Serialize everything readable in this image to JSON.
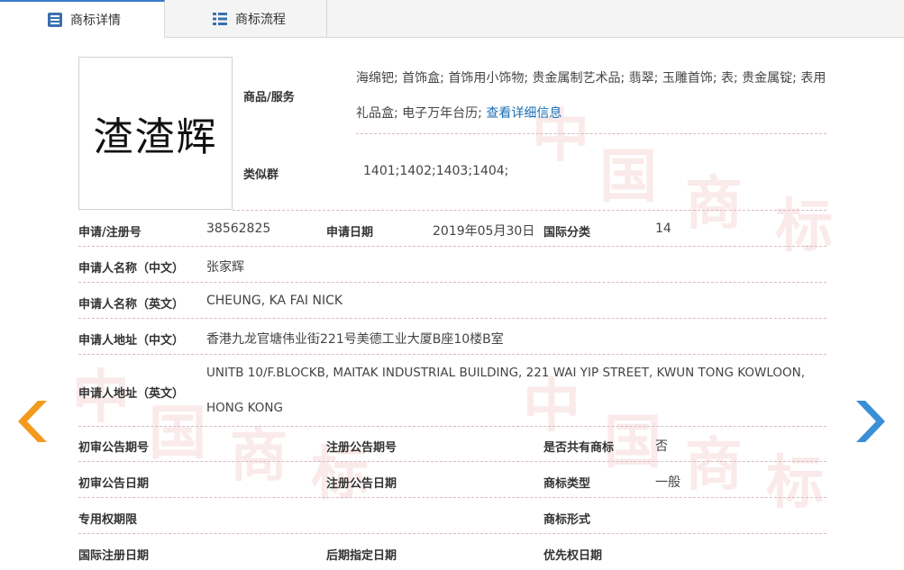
{
  "tabs": [
    {
      "label": "商标详情",
      "active": true,
      "icon": "document-list-icon"
    },
    {
      "label": "商标流程",
      "active": false,
      "icon": "grid-list-icon"
    }
  ],
  "watermark": [
    "中",
    "国",
    "商",
    "标"
  ],
  "logo": {
    "text": "渣渣辉"
  },
  "goods": {
    "label": "商品/服务",
    "line1": "海绵钯; 首饰盒; 首饰用小饰物; 贵金属制艺术品; 翡翠; 玉雕首饰; 表; 贵金属锭; 表用",
    "line2": "礼品盒; 电子万年台历;",
    "link": "查看详细信息"
  },
  "similar_group": {
    "label": "类似群",
    "value": "1401;1402;1403;1404;"
  },
  "fields": {
    "reg_no": {
      "label": "申请/注册号",
      "value": "38562825"
    },
    "app_date": {
      "label": "申请日期",
      "value": "2019年05月30日"
    },
    "intl_class": {
      "label": "国际分类",
      "value": "14"
    },
    "applicant_cn": {
      "label": "申请人名称（中文）",
      "value": "张家辉"
    },
    "applicant_en": {
      "label": "申请人名称（英文）",
      "value": "CHEUNG, KA FAI NICK"
    },
    "address_cn": {
      "label": "申请人地址（中文）",
      "value": "香港九龙官塘伟业街221号美德工业大厦B座10楼B室"
    },
    "address_en": {
      "label": "申请人地址（英文）",
      "line1": "UNITB 10/F.BLOCKB, MAITAK INDUSTRIAL BUILDING, 221 WAI YIP STREET, KWUN TONG KOWLOON,",
      "line2": "HONG KONG"
    },
    "prelim_pub_no": {
      "label": "初审公告期号",
      "value": ""
    },
    "reg_pub_no": {
      "label": "注册公告期号",
      "value": ""
    },
    "shared": {
      "label": "是否共有商标",
      "value": "否"
    },
    "prelim_pub_date": {
      "label": "初审公告日期",
      "value": ""
    },
    "reg_pub_date": {
      "label": "注册公告日期",
      "value": ""
    },
    "tm_type": {
      "label": "商标类型",
      "value": "一般"
    },
    "exclusive_period": {
      "label": "专用权期限",
      "value": ""
    },
    "tm_form": {
      "label": "商标形式",
      "value": ""
    },
    "intl_reg_date": {
      "label": "国际注册日期",
      "value": ""
    },
    "later_designation": {
      "label": "后期指定日期",
      "value": ""
    },
    "priority_date": {
      "label": "优先权日期",
      "value": ""
    }
  },
  "nav": {
    "prev_icon": "chevron-left-icon",
    "next_icon": "chevron-right-icon",
    "prev_color": "#f39a1e",
    "next_color": "#3a8fd6"
  }
}
